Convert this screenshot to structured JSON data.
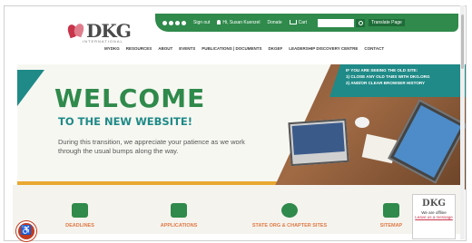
{
  "logo": {
    "text": "DKG",
    "sub": "INTERNATIONAL"
  },
  "topbar": {
    "signin": "Sign out",
    "user": "Hi, Susan Kuenzel",
    "donate": "Donate",
    "cart": "Cart",
    "search_placeholder": "",
    "translate": "Translate Page"
  },
  "nav": [
    "MYDKG",
    "RESOURCES",
    "ABOUT",
    "EVENTS",
    "PUBLICATIONS | DOCUMENTS",
    "DKGEF",
    "LEADERSHIP DISCOVERY CENTRE",
    "CONTACT"
  ],
  "hero": {
    "old_site_line1": "IF YOU ARE SEEING THE OLD SITE:",
    "old_site_line2": "1) CLOSE ANY OLD TABS WITH DKG.ORG",
    "old_site_line3": "2) AND/OR CLEAR BROWSER HISTORY",
    "welcome": "WELCOME",
    "new_site": "TO THE NEW WEBSITE!",
    "transition": "During this transition, we appreciate your patience as we work through the usual bumps along the way."
  },
  "features": [
    "DEADLINES",
    "APPLICATIONS",
    "STATE ORG & CHAPTER SITES",
    "SITEMAP"
  ],
  "chat": {
    "logo": "DKG",
    "status": "We are offline",
    "leave": "Leave us a message"
  },
  "accessibility": "accessibility-icon"
}
